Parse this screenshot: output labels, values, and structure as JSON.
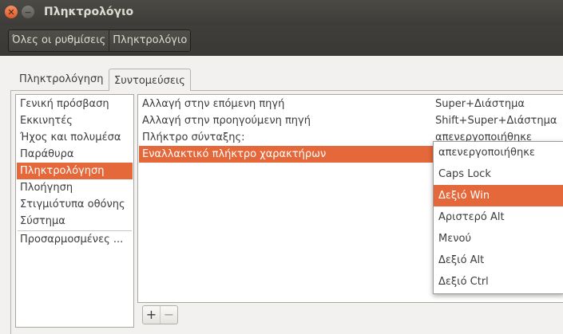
{
  "window": {
    "title": "Πληκτρολόγιο"
  },
  "toolbar": {
    "breadcrumbs": [
      "Όλες οι ρυθμίσεις",
      "Πληκτρολόγιο"
    ]
  },
  "tabs": [
    "Πληκτρολόγηση",
    "Συντομεύσεις"
  ],
  "active_tab": "Συντομεύσεις",
  "categories": [
    "Γενική πρόσβαση",
    "Εκκινητές",
    "Ήχος και πολυμέσα",
    "Παράθυρα",
    "Πληκτρολόγηση",
    "Πλοήγηση",
    "Στιγμιότυπα οθόνης",
    "Σύστημα",
    "Προσαρμοσμένες ..."
  ],
  "selected_category": "Πληκτρολόγηση",
  "shortcuts": [
    {
      "name": "Αλλαγή στην επόμενη πηγή",
      "value": "Super+Διάστημα"
    },
    {
      "name": "Αλλαγή στην προηγούμενη πηγή",
      "value": "Shift+Super+Διάστημα"
    },
    {
      "name": "Πλήκτρο σύνταξης:",
      "value": "απενεργοποιήθηκε"
    },
    {
      "name": "Εναλλακτικό πλήκτρο χαρακτήρων",
      "value": ""
    }
  ],
  "selected_shortcut": "Εναλλακτικό πλήκτρο χαρακτήρων",
  "buttons": {
    "add": "+",
    "remove": "−"
  },
  "dropdown": {
    "options": [
      "απενεργοποιήθηκε",
      "Caps Lock",
      "Δεξιό Win",
      "Αριστερό Alt",
      "Μενού",
      "Δεξιό Alt",
      "Δεξιό Ctrl"
    ],
    "selected": "Δεξιό Win"
  },
  "colors": {
    "accent": "#e5683a",
    "titlebar": "#3d3c38",
    "close_button": "#e05a2b"
  },
  "icons": {
    "close": "close-icon",
    "minimize": "minimize-icon"
  }
}
